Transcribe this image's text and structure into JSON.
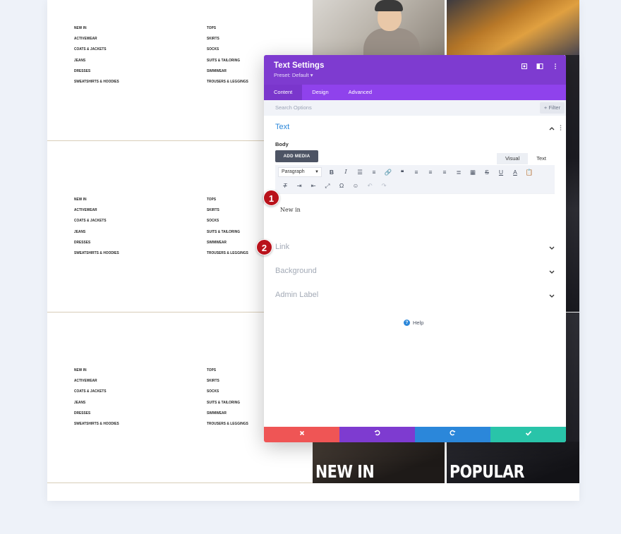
{
  "page": {
    "menu_left": [
      "New In",
      "Activewear",
      "Coats & Jackets",
      "Jeans",
      "Dresses",
      "Sweatshirts & Hoodies"
    ],
    "menu_right": [
      "Tops",
      "Skirts",
      "Socks",
      "Suits & Tailoring",
      "Swimwear",
      "Trousers & Leggings"
    ],
    "photo_labels": {
      "new_in": "NEW IN",
      "popular": "POPULAR"
    }
  },
  "modal": {
    "title": "Text Settings",
    "preset": "Preset: Default ▾",
    "tabs": [
      {
        "label": "Content"
      },
      {
        "label": "Design"
      },
      {
        "label": "Advanced"
      }
    ],
    "search_placeholder": "Search Options",
    "filter_label": "+ Filter",
    "text_section_title": "Text",
    "body_label": "Body",
    "add_media_label": "ADD MEDIA",
    "editor_tabs": {
      "visual": "Visual",
      "text": "Text"
    },
    "paragraph_select": "Paragraph",
    "editor_content": "New in",
    "collapsed_sections": [
      "Link",
      "Background",
      "Admin Label"
    ],
    "help_label": "Help"
  },
  "badges": [
    "1",
    "2"
  ],
  "colors": {
    "header": "#7e3bd0",
    "tabs": "#8f42ec",
    "accent_blue": "#2b87da",
    "cancel": "#ef5555",
    "save": "#29c4a9",
    "badge": "#b9121b"
  },
  "icons": [
    "target-icon",
    "split-view-icon",
    "more-vertical-icon",
    "chevron-up-icon",
    "chevron-down-icon",
    "help-circle-icon",
    "close-icon",
    "undo-icon",
    "redo-icon",
    "check-icon"
  ]
}
